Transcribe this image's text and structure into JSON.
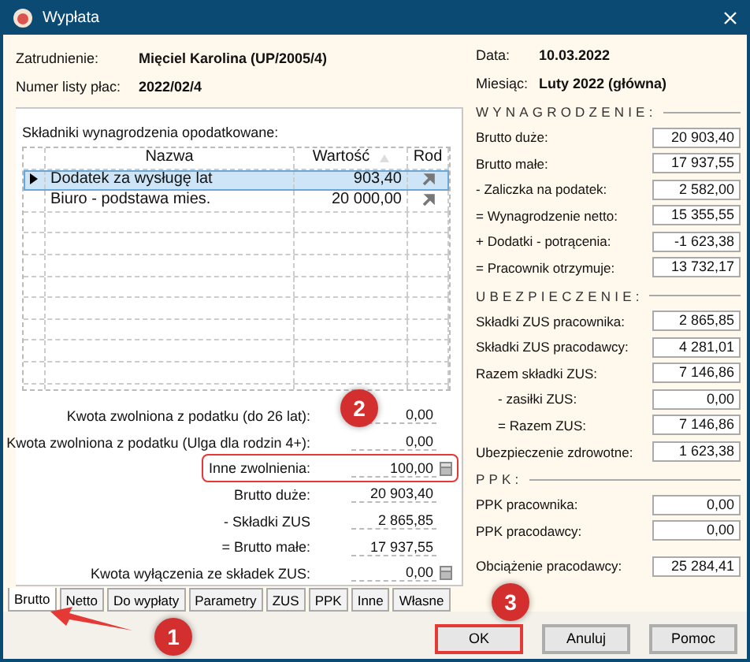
{
  "window": {
    "title": "Wypłata"
  },
  "header_left": [
    {
      "label": "Zatrudnienie:",
      "value": "Mięciel Karolina (UP/2005/4)"
    },
    {
      "label": "Numer listy płac:",
      "value": "2022/02/4"
    }
  ],
  "header_right": [
    {
      "label": "Data:",
      "value": "10.03.2022"
    },
    {
      "label": "Miesiąc:",
      "value": "Luty 2022 (główna)"
    }
  ],
  "components": {
    "title": "Składniki wynagrodzenia opodatkowane:",
    "columns": [
      "Nazwa",
      "Wartość",
      "Rod"
    ],
    "rows": [
      {
        "name": "Dodatek za wysługę lat",
        "value": "903,40",
        "selected": true
      },
      {
        "name": "Biuro - podstawa mies.",
        "value": "20 000,00",
        "selected": false
      }
    ]
  },
  "summary": [
    {
      "label": "Kwota zwolniona z podatku (do 26 lat):",
      "value": "0,00",
      "calculator": false,
      "highlighted": false
    },
    {
      "label": "Kwota zwolniona z podatku (Ulga dla rodzin 4+):",
      "value": "0,00",
      "calculator": false,
      "highlighted": false
    },
    {
      "label": "Inne zwolnienia:",
      "value": "100,00",
      "calculator": true,
      "highlighted": true
    },
    {
      "label": "Brutto duże:",
      "value": "20 903,40",
      "calculator": false,
      "highlighted": false
    },
    {
      "label": "-  Składki ZUS",
      "value": "2 865,85",
      "calculator": false,
      "highlighted": false
    },
    {
      "label": "= Brutto małe:",
      "value": "17 937,55",
      "calculator": false,
      "highlighted": false
    },
    {
      "label": "Kwota wyłączenia ze składek ZUS:",
      "value": "0,00",
      "calculator": true,
      "highlighted": false
    }
  ],
  "tabs": [
    {
      "label": "Brutto",
      "selected": true
    },
    {
      "label": "Netto",
      "selected": false
    },
    {
      "label": "Do wypłaty",
      "selected": false
    },
    {
      "label": "Parametry",
      "selected": false
    },
    {
      "label": "ZUS",
      "selected": false
    },
    {
      "label": "PPK",
      "selected": false
    },
    {
      "label": "Inne",
      "selected": false
    },
    {
      "label": "Własne",
      "selected": false
    }
  ],
  "sections": [
    {
      "title": "WYNAGRODZENIE:",
      "rows": [
        {
          "label": "Brutto duże:",
          "value": "20 903,40",
          "indented": false
        },
        {
          "label": "Brutto małe:",
          "value": "17 937,55",
          "indented": false
        },
        {
          "label": "- Zaliczka na podatek:",
          "value": "2 582,00",
          "indented": false
        },
        {
          "label": "= Wynagrodzenie netto:",
          "value": "15 355,55",
          "indented": false
        },
        {
          "label": "+ Dodatki - potrącenia:",
          "value": "-1 623,38",
          "indented": false
        },
        {
          "label": "= Pracownik otrzymuje:",
          "value": "13 732,17",
          "indented": false
        }
      ]
    },
    {
      "title": "UBEZPIECZENIE:",
      "rows": [
        {
          "label": "Składki ZUS pracownika:",
          "value": "2 865,85",
          "indented": false
        },
        {
          "label": "Składki ZUS pracodawcy:",
          "value": "4 281,01",
          "indented": false
        },
        {
          "label": "Razem składki ZUS:",
          "value": "7 146,86",
          "indented": false
        },
        {
          "label": "- zasiłki ZUS:",
          "value": "0,00",
          "indented": true
        },
        {
          "label": "= Razem ZUS:",
          "value": "7 146,86",
          "indented": true
        },
        {
          "label": "Ubezpieczenie zdrowotne:",
          "value": "1 623,38",
          "indented": false
        }
      ]
    },
    {
      "title": "PPK:",
      "rows": [
        {
          "label": "PPK pracownika:",
          "value": "0,00",
          "indented": false
        },
        {
          "label": "PPK pracodawcy:",
          "value": "0,00",
          "indented": false
        }
      ]
    }
  ],
  "employer_cost": {
    "label": "Obciążenie pracodawcy:",
    "value": "25 284,41"
  },
  "buttons": [
    {
      "label": "OK",
      "highlighted": true
    },
    {
      "label": "Anuluj",
      "highlighted": false
    },
    {
      "label": "Pomoc",
      "highlighted": false
    }
  ],
  "callouts": [
    {
      "number": "1"
    },
    {
      "number": "2"
    },
    {
      "number": "3"
    }
  ]
}
